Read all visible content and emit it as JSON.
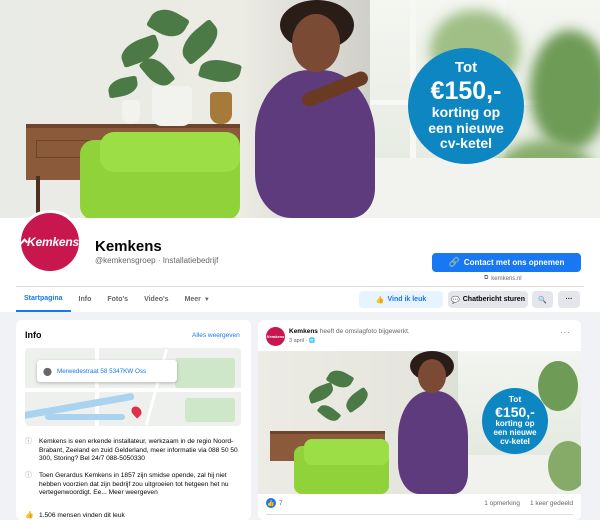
{
  "promo": {
    "line1": "Tot",
    "line2": "€150,-",
    "line3": "korting op",
    "line4": "een nieuwe",
    "line5": "cv-ketel"
  },
  "page": {
    "avatar_text": "Kemkens",
    "name": "Kemkens",
    "handle": "@kemkensgroep · Installatiebedrijf",
    "contact_label": "Contact met ons opnemen",
    "website": "kemkens.nl"
  },
  "tabs": [
    {
      "label": "Startpagina"
    },
    {
      "label": "Info"
    },
    {
      "label": "Foto's"
    },
    {
      "label": "Video's"
    },
    {
      "label": "Meer"
    }
  ],
  "actions": {
    "like": "Vind ik leuk",
    "chat": "Chatbericht sturen"
  },
  "info": {
    "title": "Info",
    "see_all": "Alles weergeven",
    "address": "Merwedestraat 58 5347KW Oss",
    "rows": [
      "Kemkens is een erkende installateur, werkzaam in de regio Noord-Brabant, Zeeland en zuid Gelderland, meer informatie via 088 50 50 300, Storing? Bel 24/7 088-5050330",
      "Toen Gerardus Kemkens in 1857 zijn smidse opende, zal hij niet hebben voorzien dat zijn bedrijf zou uitgroeien tot hetgeen het nu vertegenwoordigt. Ee... Meer weergeven",
      "1.506 mensen vinden dit leuk"
    ]
  },
  "post": {
    "avatar_text": "Kemkens",
    "author": "Kemkens",
    "action": " heeft de omslagfoto bijgewerkt.",
    "date": "3 april · ",
    "likes": "7",
    "comments": "1 opmerking",
    "shares": "1 keer gedeeld"
  }
}
